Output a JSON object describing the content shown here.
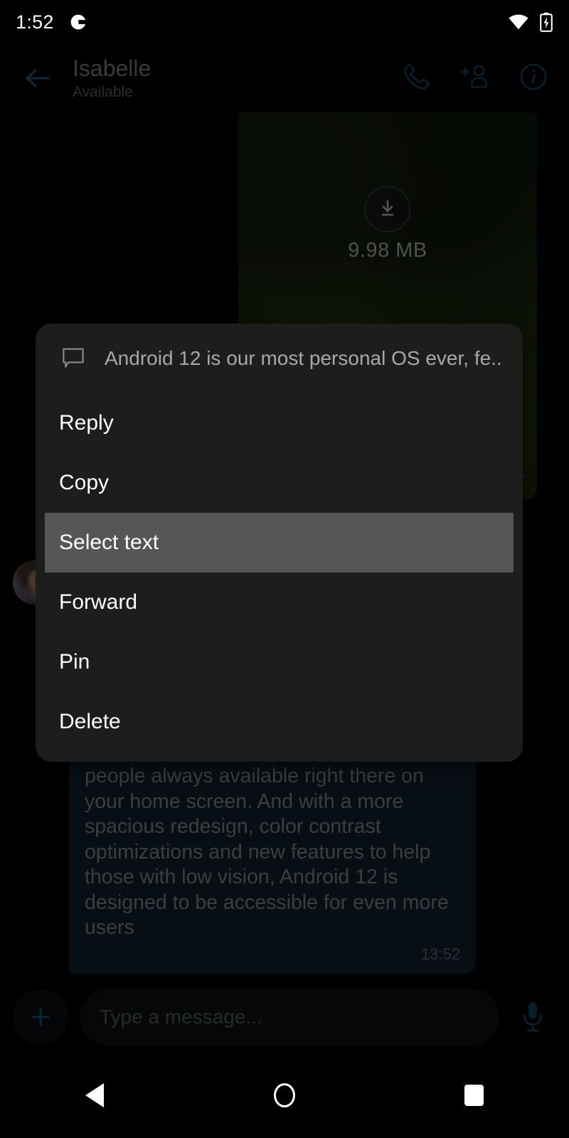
{
  "status_bar": {
    "time": "1:52",
    "app_icon": "notification-app-icon",
    "wifi_icon": "wifi-icon",
    "battery_icon": "battery-charging-icon"
  },
  "chat_header": {
    "back_icon": "back-arrow-icon",
    "contact_name": "Isabelle",
    "contact_status": "Available",
    "actions": [
      {
        "icon": "phone-call-icon",
        "name": "call-button"
      },
      {
        "icon": "add-person-icon",
        "name": "add-participant-button"
      },
      {
        "icon": "info-circle-icon",
        "name": "conversation-info-button"
      }
    ]
  },
  "conversation": {
    "image_message": {
      "download_icon": "download-arrow-icon",
      "file_size": "9.98 MB",
      "read_receipt_icon": "double-check-icon"
    },
    "avatar": "contact-avatar",
    "text_message": {
      "body": "people always available right there on your home screen. And with a more spacious redesign, color contrast optimizations and new features to help those with low vision, Android 12 is designed to be accessible for even more users",
      "timestamp": "13:52"
    }
  },
  "context_menu": {
    "header": {
      "icon": "message-bubble-icon",
      "preview": "Android 12 is our most personal OS ever, fe..."
    },
    "items": [
      {
        "label": "Reply",
        "name": "menu-item-reply",
        "highlighted": false
      },
      {
        "label": "Copy",
        "name": "menu-item-copy",
        "highlighted": false
      },
      {
        "label": "Select text",
        "name": "menu-item-select-text",
        "highlighted": true
      },
      {
        "label": "Forward",
        "name": "menu-item-forward",
        "highlighted": false
      },
      {
        "label": "Pin",
        "name": "menu-item-pin",
        "highlighted": false
      },
      {
        "label": "Delete",
        "name": "menu-item-delete",
        "highlighted": false
      }
    ]
  },
  "input_bar": {
    "attach_label": "+",
    "placeholder": "Type a message...",
    "mic_icon": "microphone-icon"
  },
  "navigation_bar": {
    "back": "nav-back-button",
    "home": "nav-home-button",
    "recents": "nav-recents-button"
  },
  "colors": {
    "accent_blue": "#1a5a80",
    "bubble_incoming": "#132430",
    "menu_surface": "#1d1d1d",
    "menu_highlight": "#565656",
    "background": "#000000"
  }
}
